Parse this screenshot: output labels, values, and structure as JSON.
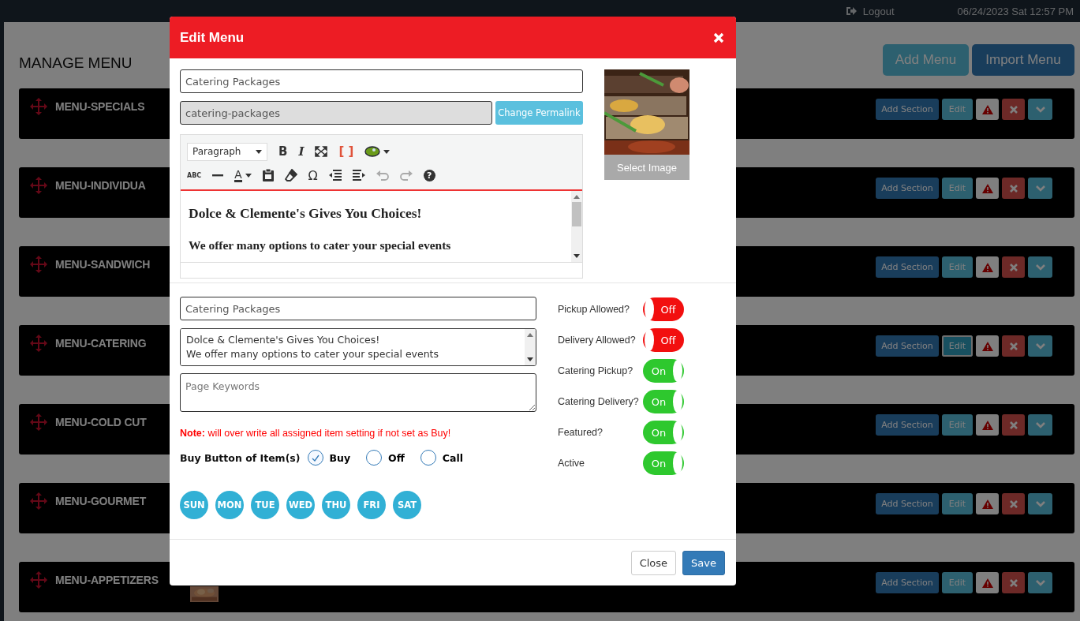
{
  "top_bar": {
    "logout": "Logout",
    "datetime": "06/24/2023 Sat 12:57 PM"
  },
  "page": {
    "title": "MANAGE MENU",
    "buttons": [
      "Add Menu",
      "Import Menu"
    ]
  },
  "menus": [
    {
      "name": "MENU-SPECIALS",
      "add_section": "Add Section",
      "edit": "Edit",
      "edit_focused": false
    },
    {
      "name": "MENU-INDIVIDUA",
      "add_section": "Add Section",
      "edit": "Edit",
      "edit_focused": false
    },
    {
      "name": "MENU-SANDWICH",
      "add_section": "Add Section",
      "edit": "Edit",
      "edit_focused": false
    },
    {
      "name": "MENU-CATERING",
      "add_section": "Add Section",
      "edit": "Edit",
      "edit_focused": true
    },
    {
      "name": "MENU-COLD CUT",
      "add_section": "Add Section",
      "edit": "Edit",
      "edit_focused": false
    },
    {
      "name": "MENU-GOURMET",
      "add_section": "Add Section",
      "edit": "Edit",
      "edit_focused": false
    },
    {
      "name": "MENU-APPETIZERS",
      "add_section": "Add Section",
      "edit": "Edit",
      "edit_focused": false
    }
  ],
  "modal": {
    "title": "Edit Menu",
    "name_field": {
      "value": "Catering Packages"
    },
    "permalink_field": {
      "value": "catering-packages"
    },
    "change_permalink": "Change Permalink",
    "select_image": "Select Image",
    "editor": {
      "format": "Paragraph",
      "glyphs": {
        "bold": "B",
        "italic": "I",
        "code": "[ ]",
        "spellcheck": "ABC",
        "text_color": "A",
        "special_char": "Ω",
        "help": "?"
      },
      "heading": "Dolce & Clemente's Gives You Choices!",
      "paragraph": "We offer many options to cater your special events"
    },
    "title_field": {
      "value": "Catering Packages"
    },
    "description_field": {
      "value": "Dolce & Clemente's Gives You Choices!\nWe offer many options to cater your special events"
    },
    "keywords_field": {
      "placeholder": "Page Keywords"
    },
    "note": "**Note:** will over write all assigned item setting if not set as Buy!",
    "buy_button": {
      "label": "Buy Button of Item(s)",
      "options": [
        {
          "label": "Buy",
          "selected": true
        },
        {
          "label": "Off",
          "selected": false
        },
        {
          "label": "Call",
          "selected": false
        }
      ]
    },
    "days": [
      "SUN",
      "MON",
      "TUE",
      "WED",
      "THU",
      "FRI",
      "SAT"
    ],
    "toggles": [
      {
        "label": "Pickup Allowed?",
        "on": false,
        "text": "Off"
      },
      {
        "label": "Delivery Allowed?",
        "on": false,
        "text": "Off"
      },
      {
        "label": "Catering Pickup?",
        "on": true,
        "text": "On"
      },
      {
        "label": "Catering Delivery?",
        "on": true,
        "text": "On"
      },
      {
        "label": "Featured?",
        "on": true,
        "text": "On"
      },
      {
        "label": "Active",
        "on": true,
        "text": "On"
      }
    ],
    "footer": {
      "close": "Close",
      "save": "Save"
    }
  }
}
